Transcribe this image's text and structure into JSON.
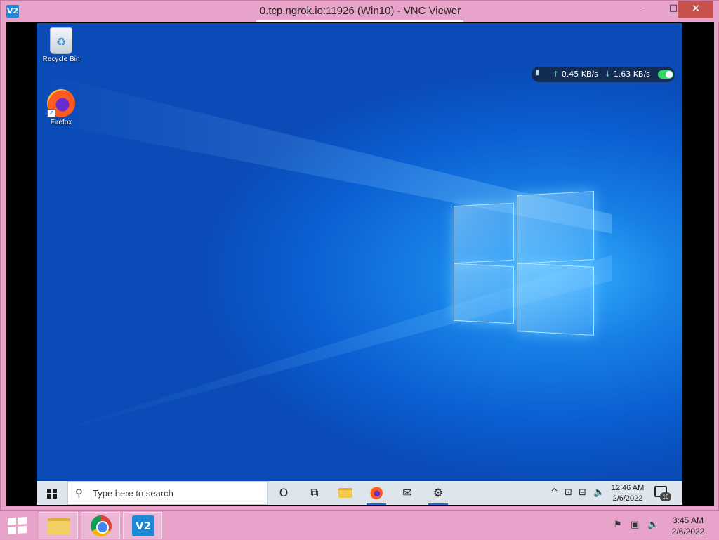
{
  "vnc_window": {
    "app_icon_text": "V2",
    "title": "0.tcp.ngrok.io:11926 (Win10) - VNC Viewer",
    "min_symbol": "–",
    "max_symbol": "□",
    "close_symbol": "✕"
  },
  "remote_desktop": {
    "icons": [
      {
        "label": "Recycle Bin",
        "icon": "recycle-bin-icon"
      },
      {
        "label": "Firefox",
        "icon": "firefox-icon"
      }
    ],
    "net_widget": {
      "upload_arrow": "↑",
      "upload": "0.45 KB/s",
      "download_arrow": "↓",
      "download": "1.63 KB/s",
      "toggle_on": true,
      "accent": "#39d66a"
    }
  },
  "remote_taskbar": {
    "search_icon": "⚲",
    "search_placeholder": "Type here to search",
    "cortana_icon": "O",
    "task_view_icon": "⧉",
    "mail_icon": "✉",
    "settings_icon": "⚙",
    "tray_chevron": "^",
    "tray_icons": [
      "⊡",
      "⊟",
      "🔈"
    ],
    "time": "12:46 AM",
    "date": "2/6/2022",
    "notification_count": "16"
  },
  "host_taskbar": {
    "apps": [
      "file-explorer-icon",
      "chrome-icon",
      "vnc-viewer-icon"
    ],
    "vnc_label": "V2",
    "tray_icons": [
      "⚑",
      "▣",
      "🔈"
    ],
    "time": "3:45 AM",
    "date": "2/6/2022"
  },
  "colors": {
    "frame": "#e7a3c9",
    "close_button": "#c7514d",
    "desktop_blue": "#0b5fd2"
  }
}
